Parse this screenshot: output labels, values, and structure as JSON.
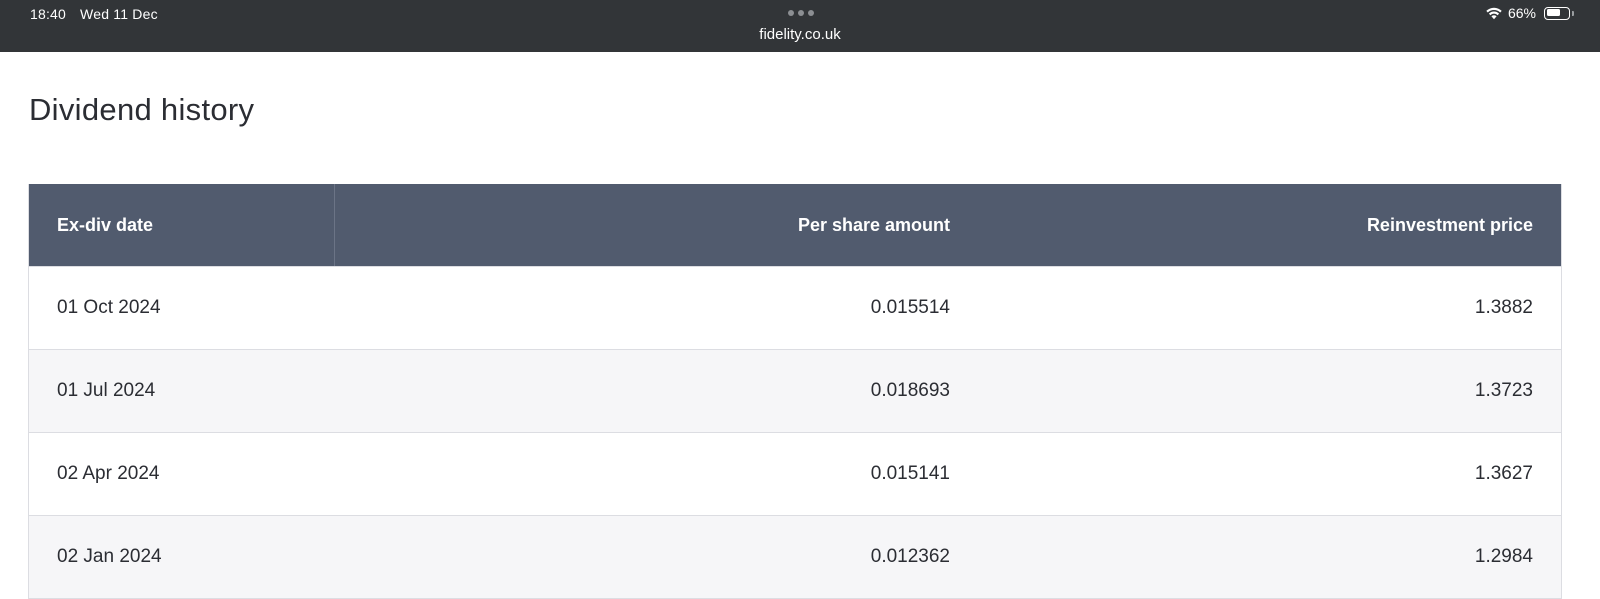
{
  "status_bar": {
    "time": "18:40",
    "date": "Wed 11 Dec",
    "url": "fidelity.co.uk",
    "battery_percent": "66%",
    "battery_level": 0.66
  },
  "page": {
    "title": "Dividend history"
  },
  "table": {
    "headers": {
      "date": "Ex-div date",
      "amount": "Per share amount",
      "price": "Reinvestment price"
    },
    "rows": [
      {
        "date": "01 Oct 2024",
        "amount": "0.015514",
        "price": "1.3882"
      },
      {
        "date": "01 Jul 2024",
        "amount": "0.018693",
        "price": "1.3723"
      },
      {
        "date": "02 Apr 2024",
        "amount": "0.015141",
        "price": "1.3627"
      },
      {
        "date": "02 Jan 2024",
        "amount": "0.012362",
        "price": "1.2984"
      }
    ]
  },
  "colors": {
    "status_bar_bg": "#323538",
    "table_header_bg": "#515b6e",
    "row_alt_bg": "#f6f6f8"
  },
  "icons": [
    "wifi-icon",
    "battery-icon",
    "more-dots-icon"
  ]
}
